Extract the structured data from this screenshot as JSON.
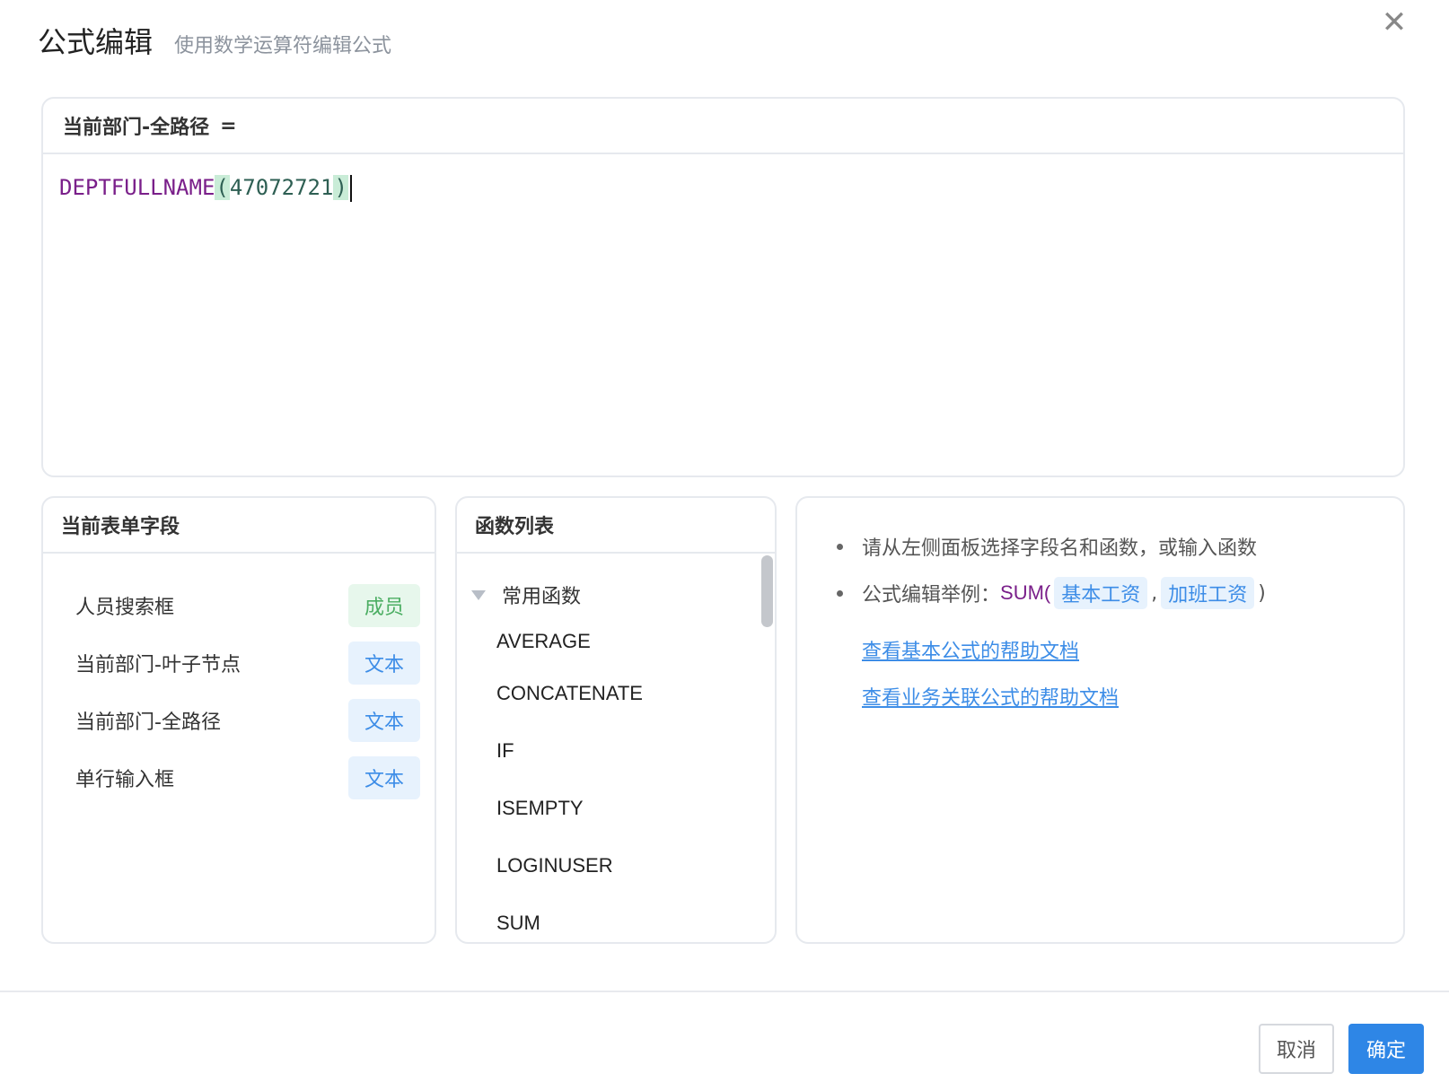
{
  "dialog": {
    "title": "公式编辑",
    "subtitle": "使用数学运算符编辑公式",
    "close_icon": "close-icon"
  },
  "editor": {
    "target_field": "当前部门-全路径",
    "equals": "=",
    "formula": {
      "function": "DEPTFULLNAME",
      "open_paren": "(",
      "argument": "47072721",
      "close_paren": ")"
    }
  },
  "fields_panel": {
    "title": "当前表单字段",
    "items": [
      {
        "name": "人员搜索框",
        "type": "成员"
      },
      {
        "name": "当前部门-叶子节点",
        "type": "文本"
      },
      {
        "name": "当前部门-全路径",
        "type": "文本"
      },
      {
        "name": "单行输入框",
        "type": "文本"
      }
    ]
  },
  "functions_panel": {
    "title": "函数列表",
    "group": "常用函数",
    "items": [
      "AVERAGE",
      "CONCATENATE",
      "IF",
      "ISEMPTY",
      "LOGINUSER",
      "SUM"
    ]
  },
  "help_panel": {
    "tip": "请从左侧面板选择字段名和函数，或输入函数",
    "example_label": "公式编辑举例：",
    "example_fn": "SUM(",
    "example_args": [
      "基本工资",
      "加班工资"
    ],
    "example_sep": ",",
    "example_close": ")",
    "links": [
      "查看基本公式的帮助文档",
      "查看业务关联公式的帮助文档"
    ]
  },
  "footer": {
    "cancel_label": "取消",
    "confirm_label": "确定"
  },
  "colors": {
    "accent": "#2e86e6",
    "function_purple": "#7a1f8a",
    "tag_member": "#4cae63",
    "tag_text": "#3d8de7"
  }
}
